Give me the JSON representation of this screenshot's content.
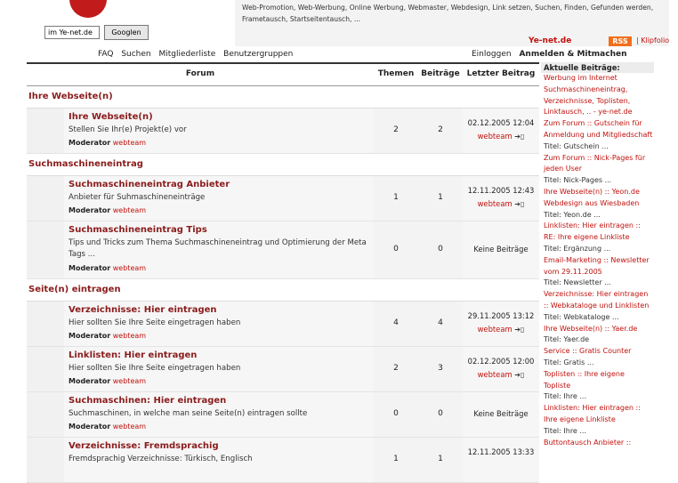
{
  "header": {
    "tagline": "Web-Promotion, Web-Werbung, Online Werbung, Webmaster, Webdesign, Link setzen, Suchen, Finden, Gefunden werden, Frametausch, Startseitentausch, ...",
    "search_value": "im Ye-net.de",
    "search_button": "Googlen",
    "site_link": "Ye-net.de",
    "rss": "RSS",
    "portfolio": "| Klipfolio"
  },
  "nav": {
    "faq": "FAQ",
    "search": "Suchen",
    "members": "Mitgliederliste",
    "groups": "Benutzergruppen",
    "login": "Einloggen",
    "register": "Anmelden & Mitmachen"
  },
  "table": {
    "col_forum": "Forum",
    "col_topics": "Themen",
    "col_posts": "Beiträge",
    "col_last": "Letzter Beitrag"
  },
  "categories": [
    {
      "title": "Ihre Webseite(n)"
    },
    {
      "title": "Suchmaschineneintrag"
    },
    {
      "title": "Seite(n) eintragen"
    }
  ],
  "forums": [
    {
      "title": "Ihre Webseite(n)",
      "desc": "Stellen Sie Ihr(e) Projekt(e) vor",
      "mod_label": "Moderator",
      "mod": "webteam",
      "topics": "2",
      "posts": "2",
      "last_date": "02.12.2005 12:04",
      "last_user": "webteam"
    },
    {
      "title": "Suchmaschineneintrag Anbieter",
      "desc": "Anbieter für Suhmaschineneinträge",
      "mod_label": "Moderator",
      "mod": "webteam",
      "topics": "1",
      "posts": "1",
      "last_date": "12.11.2005 12:43",
      "last_user": "webteam"
    },
    {
      "title": "Suchmaschineneintrag Tips",
      "desc": "Tips und Tricks zum Thema Suchmaschineneintrag und Optimierung der Meta Tags ...",
      "mod_label": "Moderator",
      "mod": "webteam",
      "topics": "0",
      "posts": "0",
      "last_none": "Keine Beiträge"
    },
    {
      "title": "Verzeichnisse: Hier eintragen",
      "desc": "Hier sollten Sie Ihre Seite eingetragen haben",
      "mod_label": "Moderator",
      "mod": "webteam",
      "topics": "4",
      "posts": "4",
      "last_date": "29.11.2005 13:12",
      "last_user": "webteam"
    },
    {
      "title": "Linklisten: Hier eintragen",
      "desc": "Hier sollten Sie Ihre Seite eingetragen haben",
      "mod_label": "Moderator",
      "mod": "webteam",
      "topics": "2",
      "posts": "3",
      "last_date": "02.12.2005 12:00",
      "last_user": "webteam"
    },
    {
      "title": "Suchmaschinen: Hier eintragen",
      "desc": "Suchmaschinen, in welche man seine Seite(n) eintragen sollte",
      "mod_label": "Moderator",
      "mod": "webteam",
      "topics": "0",
      "posts": "0",
      "last_none": "Keine Beiträge"
    },
    {
      "title": "Verzeichnisse: Fremdsprachig",
      "desc": "Fremdsprachig Verzeichnisse: Türkisch, Englisch",
      "topics": "1",
      "posts": "1",
      "last_date": "12.11.2005 13:33"
    }
  ],
  "sidebar": {
    "heading": "Aktuelle Beiträge:",
    "items": [
      {
        "kind": "link",
        "text": "Werbung im Internet"
      },
      {
        "kind": "link",
        "text": "Suchmaschineneintrag,"
      },
      {
        "kind": "link",
        "text": "Verzeichnisse, Toplisten,"
      },
      {
        "kind": "link",
        "text": "Linktausch, .. - ye-net.de"
      },
      {
        "kind": "link",
        "text": "Zum Forum :: Gutschein für"
      },
      {
        "kind": "link",
        "text": "Anmeldung und Mitgliedschaft"
      },
      {
        "kind": "text",
        "text": "Titel: Gutschein ..."
      },
      {
        "kind": "link",
        "text": "Zum Forum :: Nick-Pages für"
      },
      {
        "kind": "link",
        "text": "jeden User"
      },
      {
        "kind": "text",
        "text": "Titel: Nick-Pages ..."
      },
      {
        "kind": "link",
        "text": "Ihre Webseite(n) :: Yeon.de"
      },
      {
        "kind": "link",
        "text": "Webdesign aus Wiesbaden"
      },
      {
        "kind": "text",
        "text": "Titel: Yeon.de ..."
      },
      {
        "kind": "link",
        "text": "Linklisten: Hier eintragen ::"
      },
      {
        "kind": "link",
        "text": "RE: Ihre eigene Linkliste"
      },
      {
        "kind": "text",
        "text": "Titel: Ergänzung ..."
      },
      {
        "kind": "link",
        "text": "Email-Marketing :: Newsletter"
      },
      {
        "kind": "link",
        "text": "vom 29.11.2005"
      },
      {
        "kind": "text",
        "text": "Titel: Newsletter ..."
      },
      {
        "kind": "link",
        "text": "Verzeichnisse: Hier eintragen"
      },
      {
        "kind": "link",
        "text": ":: Webkataloge und Linklisten"
      },
      {
        "kind": "text",
        "text": "Titel: Webkataloge ..."
      },
      {
        "kind": "link",
        "text": "Ihre Webseite(n) :: Yaer.de"
      },
      {
        "kind": "text",
        "text": "Titel: Yaer.de"
      },
      {
        "kind": "link",
        "text": "Service :: Gratis Counter"
      },
      {
        "kind": "text",
        "text": "Titel: Gratis ..."
      },
      {
        "kind": "link",
        "text": "Toplisten :: Ihre eigene"
      },
      {
        "kind": "link",
        "text": "Topliste"
      },
      {
        "kind": "text",
        "text": "Titel: Ihre ..."
      },
      {
        "kind": "link",
        "text": "Linklisten: Hier eintragen ::"
      },
      {
        "kind": "link",
        "text": "Ihre eigene Linkliste"
      },
      {
        "kind": "text",
        "text": "Titel: Ihre ..."
      },
      {
        "kind": "link",
        "text": "Buttontausch Anbieter ::"
      }
    ]
  }
}
